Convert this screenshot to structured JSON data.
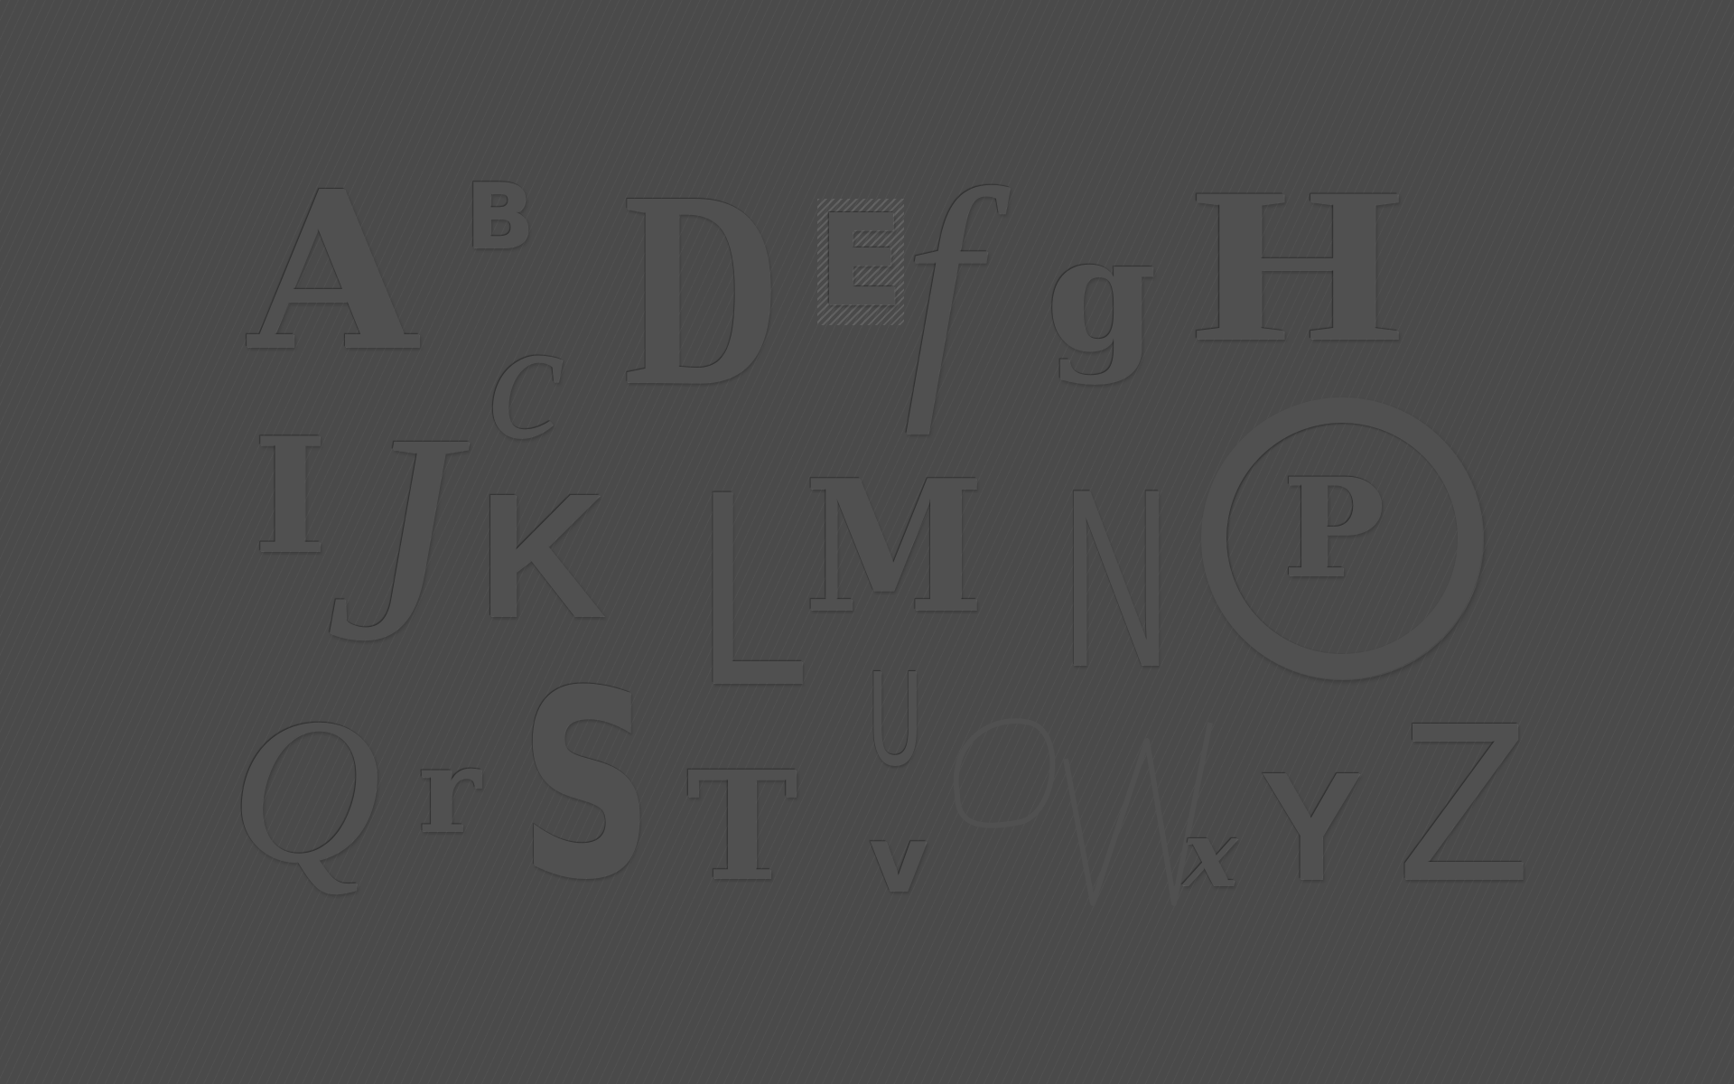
{
  "poster": {
    "letters": [
      "A",
      "B",
      "c",
      "D",
      "E",
      "f",
      "g",
      "H",
      "I",
      "J",
      "K",
      "L",
      "M",
      "N",
      "O",
      "P",
      "Q",
      "r",
      "S",
      "T",
      "U",
      "v",
      "W",
      "x",
      "Y",
      "Z"
    ]
  },
  "colors": {
    "background": "#4a4a4a",
    "letters": "#505050"
  }
}
